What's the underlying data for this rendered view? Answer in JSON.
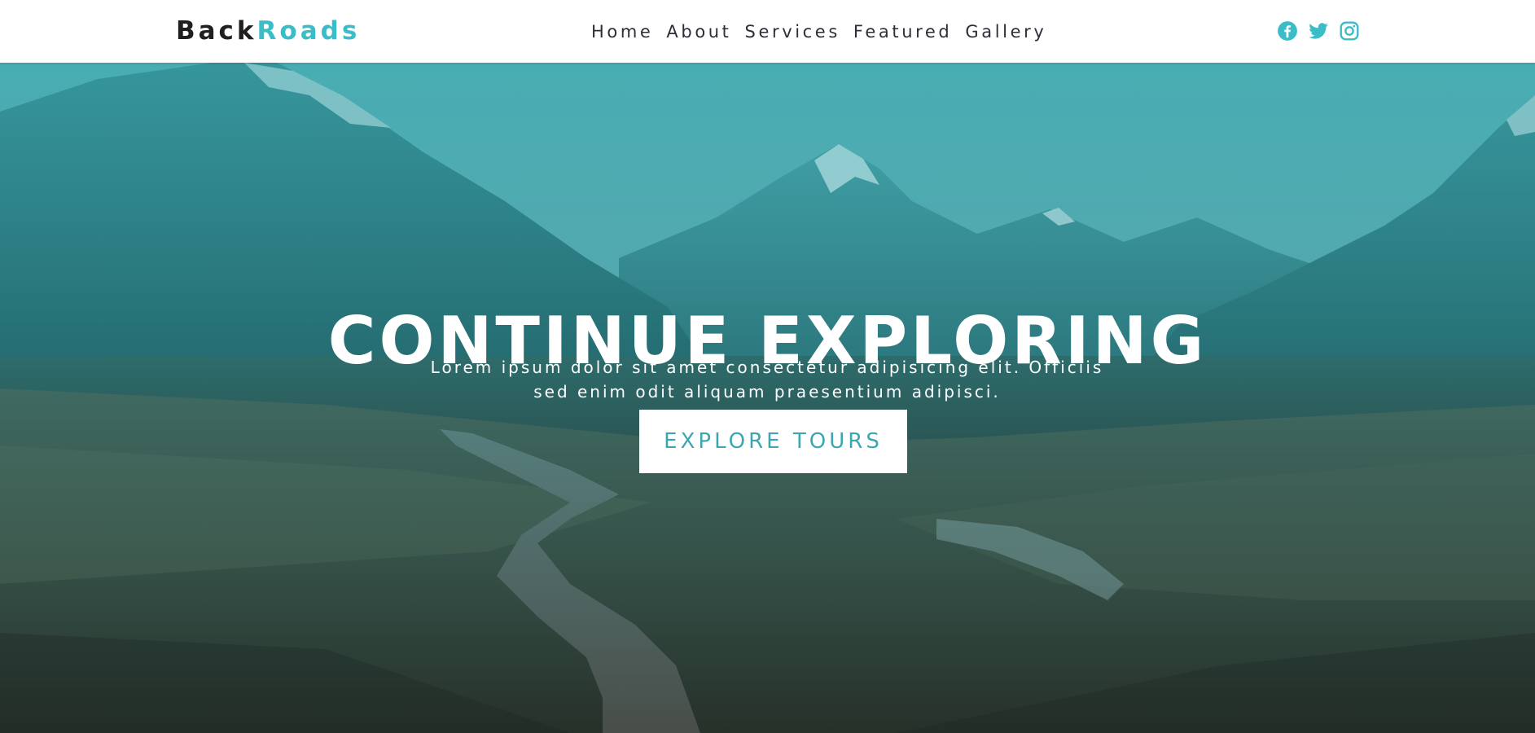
{
  "brand": {
    "part1": "Back",
    "part2": "Roads",
    "color_dark": "#1f1f1f",
    "color_accent": "#3cbcc6"
  },
  "nav": {
    "links": [
      "Home",
      "About",
      "Services",
      "Featured",
      "Gallery"
    ]
  },
  "socials": {
    "icons": [
      "facebook-icon",
      "twitter-icon",
      "instagram-icon"
    ],
    "color": "#3cbcc6"
  },
  "hero": {
    "title": "CONTINUE EXPLORING",
    "subtitle": "Lorem ipsum dolor sit amet consectetur adipisicing elit. Officiis sed enim odit aliquam praesentium adipisci.",
    "button_label": "EXPLORE TOURS",
    "overlay_color": "#2ca5ac",
    "button_text_color": "#3ba7b0"
  }
}
